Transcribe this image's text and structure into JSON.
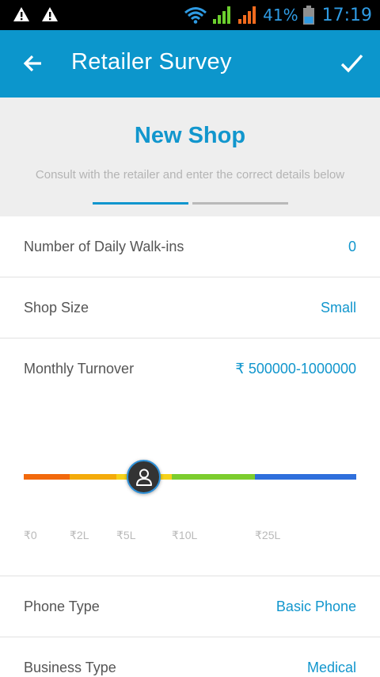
{
  "status_bar": {
    "battery_percent": "41%",
    "time": "17:19",
    "icons": [
      "warning-icon",
      "warning-icon",
      "wifi-icon",
      "signal-icon",
      "signal-icon",
      "battery-icon"
    ]
  },
  "app_bar": {
    "title": "Retailer Survey",
    "back_icon": "back-arrow-icon",
    "confirm_icon": "check-icon",
    "color": "#0c96cc"
  },
  "header": {
    "title": "New Shop",
    "subtitle": "Consult with the retailer and enter the correct details below",
    "steps": {
      "total": 2,
      "current": 1
    }
  },
  "fields": {
    "walkins": {
      "label": "Number of Daily Walk-ins",
      "value": "0"
    },
    "shop_size": {
      "label": "Shop Size",
      "value": "Small"
    },
    "turnover": {
      "label": "Monthly Turnover",
      "value": "₹ 500000-1000000",
      "slider": {
        "ticks": [
          "₹0",
          "₹2L",
          "₹5L",
          "₹10L",
          "₹25L"
        ],
        "selected_range": "₹5L-₹10L",
        "thumb_icon": "person-icon"
      }
    },
    "phone_type": {
      "label": "Phone Type",
      "value": "Basic Phone"
    },
    "business_type": {
      "label": "Business Type",
      "value": "Medical"
    }
  },
  "colors": {
    "accent": "#1196cd",
    "slider_segments": [
      "#f2690c",
      "#f4ab0a",
      "#f6d21a",
      "#7ccd2e",
      "#2f6fdc"
    ]
  }
}
